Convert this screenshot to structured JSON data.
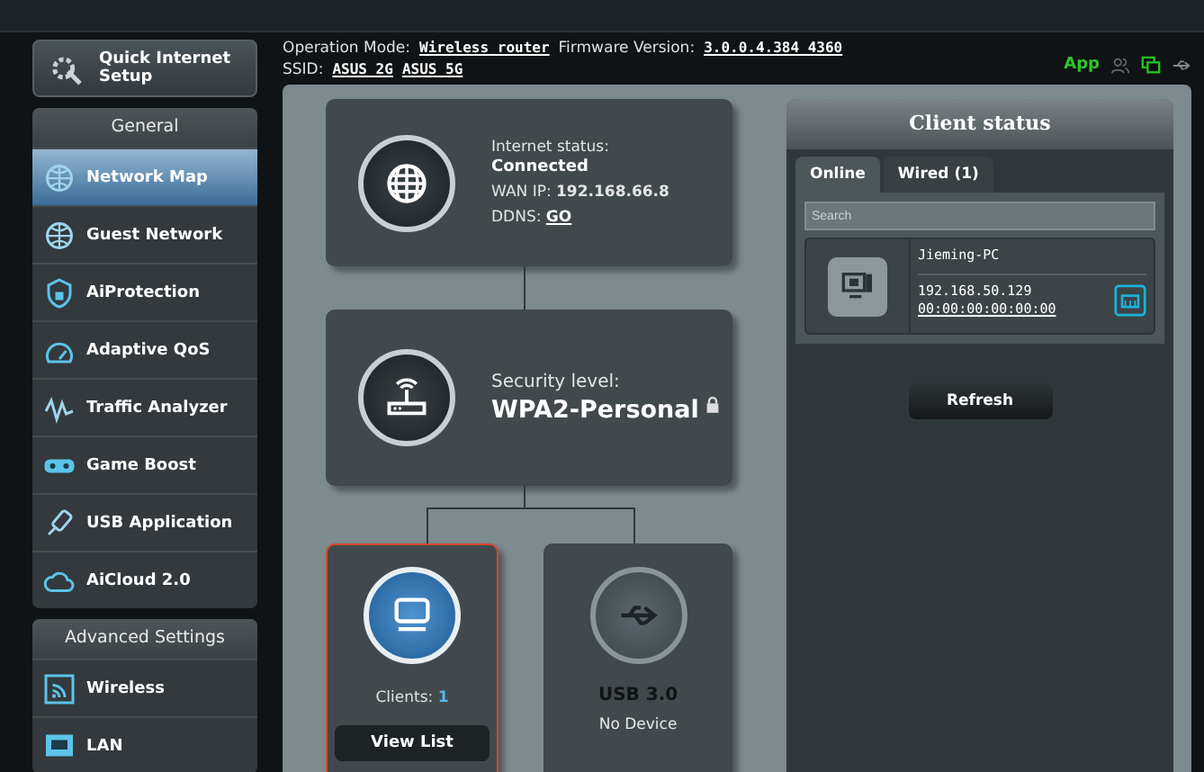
{
  "header": {
    "operation_mode_label": "Operation Mode:",
    "operation_mode": "Wireless router",
    "firmware_label": "Firmware Version:",
    "firmware": "3.0.0.4.384_4360",
    "ssid_label": "SSID:",
    "ssids": [
      "ASUS_2G",
      "ASUS_5G"
    ],
    "app_label": "App"
  },
  "quick_setup": {
    "label": "Quick Internet Setup"
  },
  "sidebar": {
    "sections": [
      {
        "title": "General",
        "items": [
          {
            "label": "Network Map",
            "selected": true
          },
          {
            "label": "Guest Network",
            "selected": false
          },
          {
            "label": "AiProtection",
            "selected": false
          },
          {
            "label": "Adaptive QoS",
            "selected": false
          },
          {
            "label": "Traffic Analyzer",
            "selected": false
          },
          {
            "label": "Game Boost",
            "selected": false
          },
          {
            "label": "USB Application",
            "selected": false
          },
          {
            "label": "AiCloud 2.0",
            "selected": false
          }
        ]
      },
      {
        "title": "Advanced Settings",
        "items": [
          {
            "label": "Wireless",
            "selected": false
          },
          {
            "label": "LAN",
            "selected": false
          }
        ]
      }
    ]
  },
  "internet": {
    "status_label": "Internet status:",
    "status": "Connected",
    "wan_ip_label": "WAN IP:",
    "wan_ip": "192.168.66.8",
    "ddns_label": "DDNS:",
    "ddns_link": "GO"
  },
  "security": {
    "label": "Security level:",
    "value": "WPA2-Personal"
  },
  "clients_node": {
    "label": "Clients:",
    "count": "1",
    "button": "View List",
    "selected": true
  },
  "usb_node": {
    "title": "USB 3.0",
    "status": "No Device",
    "selected": false
  },
  "client_status": {
    "title": "Client status",
    "tabs": [
      {
        "label": "Online",
        "selected": true
      },
      {
        "label": "Wired (1)",
        "selected": false
      }
    ],
    "search": {
      "placeholder": "Search"
    },
    "clients": [
      {
        "name": "Jieming-PC",
        "ip": "192.168.50.129",
        "mac": "00:00:00:00:00:00"
      }
    ],
    "refresh": "Refresh"
  }
}
